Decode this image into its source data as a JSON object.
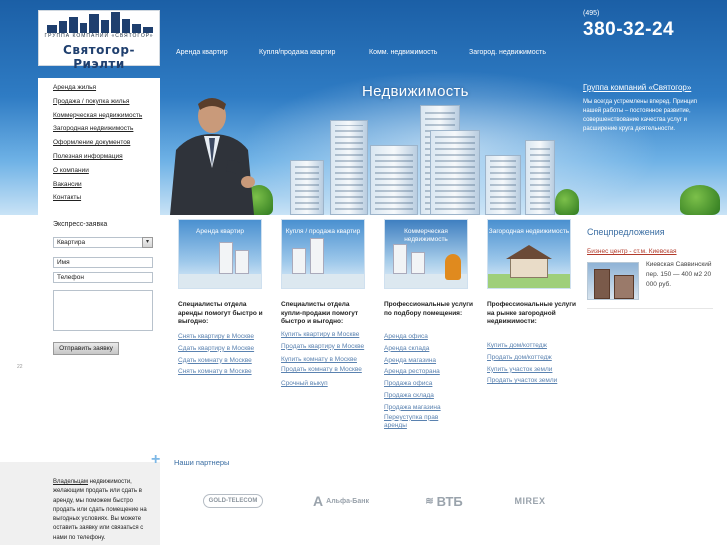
{
  "logo": {
    "tagline": "ГРУППА КОМПАНИЙ «СВЯТОГОР»",
    "name": "Святогор-Риэлти"
  },
  "top_nav": [
    {
      "label": "Аренда квартир"
    },
    {
      "label": "Купля/продажа квартир"
    },
    {
      "label": "Комм. недвижимость"
    },
    {
      "label": "Загород. недвижимость"
    }
  ],
  "contact": {
    "code": "(495)",
    "phone": "380-32-24"
  },
  "group": {
    "link": "Группа компаний «Святогор»",
    "description": "Мы всегда устремлены вперед. Принцип нашей работы – постоянное развитие, совершенствование качества услуг и расширение круга деятельности."
  },
  "hero": {
    "title": "Недвижимость"
  },
  "left_menu": [
    {
      "label": "Аренда жилья"
    },
    {
      "label": "Продажа / покупка жилья"
    },
    {
      "label": "Коммерческая недвижимость"
    },
    {
      "label": "Загородная недвижимость"
    },
    {
      "label": "Оформление документов"
    },
    {
      "label": "Полезная информация"
    },
    {
      "label": "О компании"
    },
    {
      "label": "Вакансии"
    },
    {
      "label": "Контакты"
    }
  ],
  "express_form": {
    "title": "Экспресс-заявка",
    "select_value": "Квартира",
    "name_placeholder": "Имя",
    "phone_placeholder": "Телефон",
    "submit": "Отправить заявку"
  },
  "side_mark": "22",
  "owner_note": {
    "link": "Владельцам",
    "text": " недвижимости, желающим продать или сдать в аренду, мы поможем быстро продать или сдать помещение на выгодных условиях. Вы можете оставить заявку или связаться с нами по телефону."
  },
  "services": [
    {
      "image_label": "Аренда квартир",
      "heading": "Специалисты отдела аренды помогут быстро и выгодно:",
      "links": [
        "Снять квартиру в Москве",
        "Сдать квартиру в Москве",
        "Сдать комнату в Москве",
        "Снять комнату в Москве"
      ]
    },
    {
      "image_label": "Купля / продажа квартир",
      "heading": "Специалисты отдела купли-продажи помогут быстро и выгодно:",
      "links": [
        "Купить квартиру в Москве",
        "Продать квартиру в Москве",
        "Купить комнату в Москве",
        "Продать комнату в Москве",
        "Срочный выкуп"
      ]
    },
    {
      "image_label": "Коммерческая недвижимость",
      "heading": "Профессиональные услуги по подбору помещения:",
      "links": [
        "Аренда офиса",
        "Аренда склада",
        "Аренда магазина",
        "Аренда ресторана",
        "Продажа офиса",
        "Продажа склада",
        "Продажа магазина",
        "Переуступка прав аренды"
      ]
    },
    {
      "image_label": "Загородная недвижимость",
      "heading": "Профессиональные услуги на рынке загородной недвижимости:",
      "links": [
        "Купить дом/коттедж",
        "Продать дом/коттедж",
        "Купить участок земли",
        "Продать участок земли"
      ]
    }
  ],
  "special": {
    "title": "Спецпредложения",
    "link": "Бизнес центр - ст.м. Киевская",
    "description": "Киевская Саввинский пер. 150 — 400 м2 20 000 руб."
  },
  "partners": {
    "title": "Наши партнеры",
    "items": [
      {
        "name": "GOLD-TELECOM"
      },
      {
        "name": "Альфа-Банк"
      },
      {
        "name": "ВТБ"
      },
      {
        "name": "MIREX"
      }
    ]
  },
  "colors": {
    "link_blue": "#5a82b0",
    "heading_blue": "#3b6ea3",
    "accent_red": "#b23a2a",
    "sky_top": "#1b5fa6"
  }
}
